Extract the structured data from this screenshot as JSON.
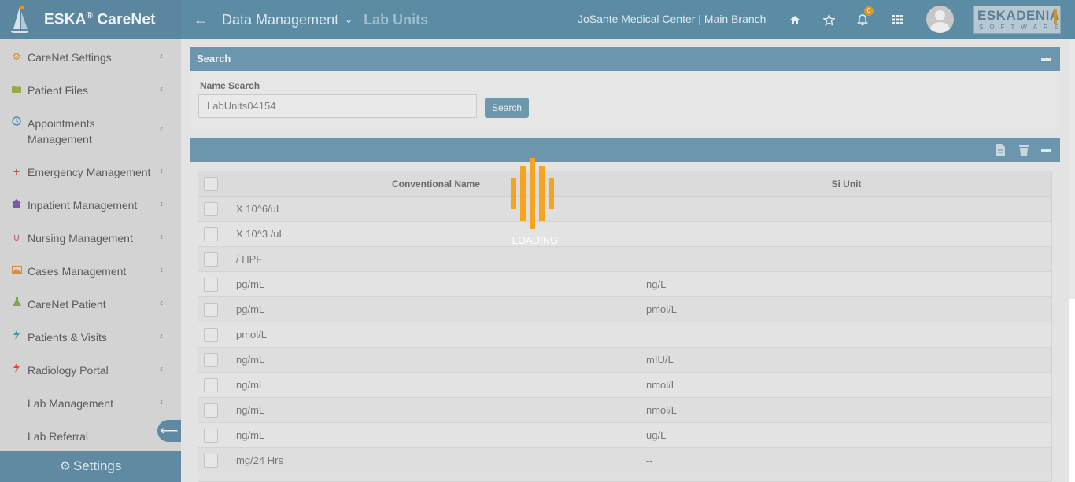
{
  "app": {
    "brand_name": "ESKA",
    "brand_reg": "®",
    "brand_suffix": " CareNet",
    "company_logo_line1": "ESKADENIA",
    "company_logo_line2": "SOFTWARE"
  },
  "header": {
    "back_icon": "arrow-left-icon",
    "breadcrumb_main": "Data Management",
    "breadcrumb_current": "Lab Units",
    "center_name": "JoSante Medical Center | Main Branch",
    "notification_count": "0",
    "icons": [
      "home-icon",
      "star-icon",
      "bell-icon",
      "grid-icon",
      "avatar"
    ]
  },
  "sidebar": {
    "items": [
      {
        "label": "CareNet Settings",
        "icon": "gear-icon",
        "color": "#d98a3a"
      },
      {
        "label": "Patient Files",
        "icon": "folder-icon",
        "color": "#9aa84a"
      },
      {
        "label": "Appointments Management",
        "icon": "clock-icon",
        "color": "#4a90b8"
      },
      {
        "label": "Emergency Management",
        "icon": "plus-icon",
        "color": "#d0503a"
      },
      {
        "label": "Inpatient Management",
        "icon": "home-icon",
        "color": "#7a5aa8"
      },
      {
        "label": "Nursing Management",
        "icon": "stethoscope-icon",
        "color": "#c0506a"
      },
      {
        "label": "Cases Management",
        "icon": "image-icon",
        "color": "#d98a3a"
      },
      {
        "label": "CareNet Patient",
        "icon": "flask-icon",
        "color": "#7aa84a"
      },
      {
        "label": "Patients & Visits",
        "icon": "bolt-icon",
        "color": "#3a9ab8"
      },
      {
        "label": "Radiology Portal",
        "icon": "bolt-icon",
        "color": "#d0503a"
      },
      {
        "label": "Lab Management",
        "icon": "",
        "color": "#777777"
      },
      {
        "label": "Lab Referral",
        "icon": "",
        "color": "#777777"
      }
    ],
    "settings_label": "Settings"
  },
  "search_panel": {
    "title": "Search",
    "name_search_label": "Name Search",
    "name_search_value": "LabUnits04154",
    "search_button": "Search"
  },
  "table": {
    "columns": [
      "Conventional Name",
      "Si Unit"
    ],
    "rows": [
      {
        "conventional": "X 10^6/uL",
        "si": ""
      },
      {
        "conventional": "X 10^3 /uL",
        "si": ""
      },
      {
        "conventional": "/ HPF",
        "si": ""
      },
      {
        "conventional": "pg/mL",
        "si": "ng/L"
      },
      {
        "conventional": "pg/mL",
        "si": "pmol/L"
      },
      {
        "conventional": "pmol/L",
        "si": ""
      },
      {
        "conventional": "ng/mL",
        "si": "mIU/L"
      },
      {
        "conventional": "ng/mL",
        "si": "nmol/L"
      },
      {
        "conventional": "ng/mL",
        "si": "nmol/L"
      },
      {
        "conventional": "ng/mL",
        "si": "ug/L"
      },
      {
        "conventional": "mg/24 Hrs",
        "si": "--"
      }
    ]
  },
  "loading": {
    "text": "LOADING",
    "color": "#f3a521"
  }
}
